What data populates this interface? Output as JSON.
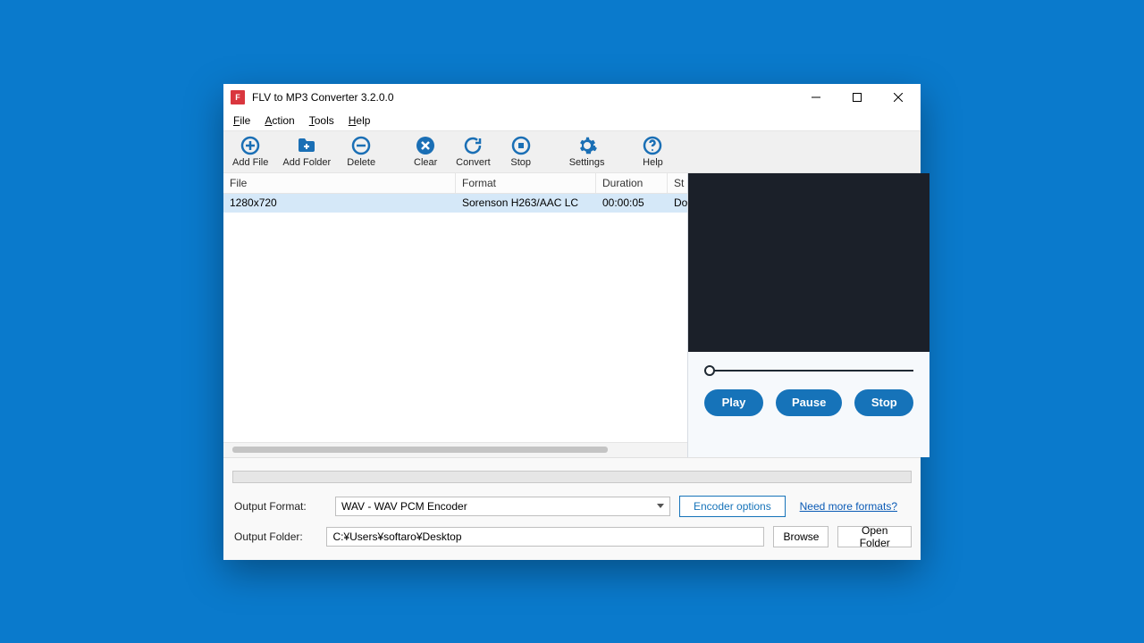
{
  "window": {
    "title": "FLV to MP3 Converter 3.2.0.0"
  },
  "menubar": {
    "file": "File",
    "action": "Action",
    "tools": "Tools",
    "help": "Help"
  },
  "toolbar": {
    "add_file": "Add File",
    "add_folder": "Add Folder",
    "delete": "Delete",
    "clear": "Clear",
    "convert": "Convert",
    "stop": "Stop",
    "settings": "Settings",
    "help": "Help"
  },
  "columns": {
    "file": "File",
    "format": "Format",
    "duration": "Duration",
    "status": "St"
  },
  "rows": [
    {
      "file": "1280x720",
      "format": "Sorenson H263/AAC LC",
      "duration": "00:00:05",
      "status": "Do"
    }
  ],
  "preview": {
    "play": "Play",
    "pause": "Pause",
    "stop": "Stop"
  },
  "output": {
    "format_label": "Output Format:",
    "format_value": "WAV - WAV PCM Encoder",
    "encoder_options": "Encoder options",
    "need_more": "Need more formats?",
    "folder_label": "Output Folder:",
    "folder_value": "C:¥Users¥softaro¥Desktop",
    "browse": "Browse",
    "open_folder": "Open Folder"
  }
}
